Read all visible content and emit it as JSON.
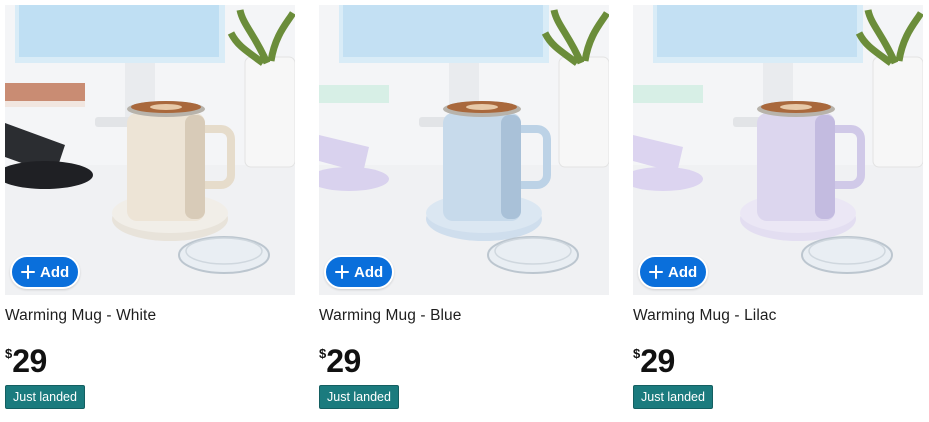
{
  "products": [
    {
      "title": "Warming Mug - White",
      "currency": "$",
      "price": "29",
      "badge": "Just landed",
      "add_label": "Add",
      "colors": {
        "mug": "#ede4d6",
        "mug_shade": "#d8cbb8",
        "base": "#e8e3da",
        "accent": "#ffffff"
      }
    },
    {
      "title": "Warming Mug - Blue",
      "currency": "$",
      "price": "29",
      "badge": "Just landed",
      "add_label": "Add",
      "colors": {
        "mug": "#c7daeb",
        "mug_shade": "#a9c1d8",
        "base": "#cfdeed",
        "accent": "#d9d2ee"
      }
    },
    {
      "title": "Warming Mug - Lilac",
      "currency": "$",
      "price": "29",
      "badge": "Just landed",
      "add_label": "Add",
      "colors": {
        "mug": "#dcd6ee",
        "mug_shade": "#c3bbe0",
        "base": "#e3def1",
        "accent": "#dcd4f0"
      }
    }
  ],
  "theme": {
    "button_blue": "#0a6fdb",
    "badge_teal": "#1b7b7e"
  }
}
